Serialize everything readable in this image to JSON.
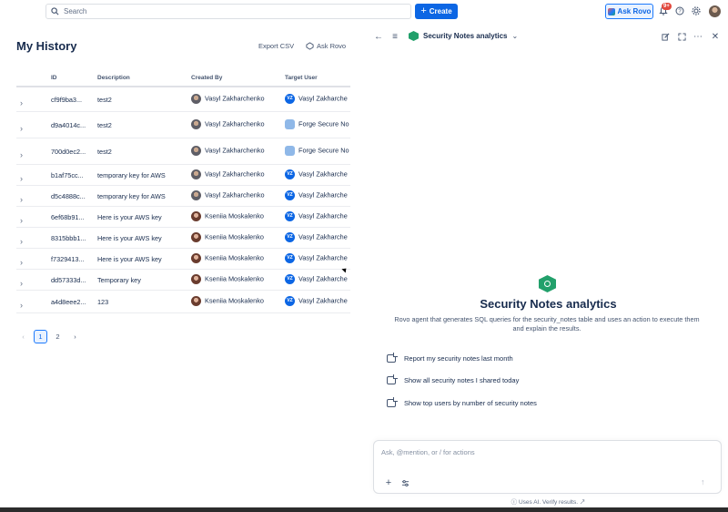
{
  "topnav": {
    "search_placeholder": "Search",
    "create_label": "Create",
    "ask_rovo_label": "Ask Rovo",
    "notifications_badge": "9+"
  },
  "history": {
    "title": "My History",
    "export_label": "Export CSV",
    "ask_rovo_label": "Ask Rovo",
    "columns": [
      "ID",
      "Description",
      "Created By",
      "Target User"
    ],
    "rows": [
      {
        "id": "cf9f9ba3...",
        "description": "test2",
        "created_by": "Vasyl Zakharchenko",
        "created_avatar": "v",
        "target_user": "Vasyl Zakharche",
        "target_avatar": "VZ",
        "target_initials": "VZ"
      },
      {
        "id": "d9a4014c...",
        "description": "test2",
        "created_by": "Vasyl Zakharchenko",
        "created_avatar": "v",
        "target_user": "Forge Secure No",
        "target_avatar": "forge",
        "target_initials": ""
      },
      {
        "id": "700d0ec2...",
        "description": "test2",
        "created_by": "Vasyl Zakharchenko",
        "created_avatar": "v",
        "target_user": "Forge Secure No",
        "target_avatar": "forge",
        "target_initials": ""
      },
      {
        "id": "b1af75cc...",
        "description": "temporary key for AWS",
        "created_by": "Vasyl Zakharchenko",
        "created_avatar": "v",
        "target_user": "Vasyl Zakharche",
        "target_avatar": "VZ",
        "target_initials": "VZ"
      },
      {
        "id": "d5c4888c...",
        "description": "temporary key for AWS",
        "created_by": "Vasyl Zakharchenko",
        "created_avatar": "v",
        "target_user": "Vasyl Zakharche",
        "target_avatar": "VZ",
        "target_initials": "VZ"
      },
      {
        "id": "6ef68b91...",
        "description": "Here is your AWS key",
        "created_by": "Kseniia Moskalenko",
        "created_avatar": "k",
        "target_user": "Vasyl Zakharche",
        "target_avatar": "VZ",
        "target_initials": "VZ"
      },
      {
        "id": "8315bbb1...",
        "description": "Here is your AWS key",
        "created_by": "Kseniia Moskalenko",
        "created_avatar": "k",
        "target_user": "Vasyl Zakharche",
        "target_avatar": "VZ",
        "target_initials": "VZ"
      },
      {
        "id": "f7329413...",
        "description": "Here is your AWS key",
        "created_by": "Kseniia Moskalenko",
        "created_avatar": "k",
        "target_user": "Vasyl Zakharche",
        "target_avatar": "VZ",
        "target_initials": "VZ"
      },
      {
        "id": "dd57333d...",
        "description": "Temporary key",
        "created_by": "Kseniia Moskalenko",
        "created_avatar": "k",
        "target_user": "Vasyl Zakharche",
        "target_avatar": "VZ",
        "target_initials": "VZ"
      },
      {
        "id": "a4d8eee2...",
        "description": "123",
        "created_by": "Kseniia Moskalenko",
        "created_avatar": "k",
        "target_user": "Vasyl Zakharche",
        "target_avatar": "VZ",
        "target_initials": "VZ"
      }
    ],
    "pagination": {
      "pages": [
        "1",
        "2"
      ],
      "current": "1"
    }
  },
  "agent": {
    "header_title": "Security Notes analytics",
    "title": "Security Notes analytics",
    "description": "Rovo agent that generates SQL queries for the security_notes table and uses an action to execute them and explain the results.",
    "suggestions": [
      "Report my security notes last month",
      "Show all security notes I shared today",
      "Show top users by number of security notes"
    ],
    "composer_placeholder": "Ask, @mention, or / for actions",
    "footer_note": "Uses AI. Verify results."
  },
  "colors": {
    "primary": "#0c66e4",
    "agent_green": "#22a06b",
    "text": "#172b4d"
  }
}
